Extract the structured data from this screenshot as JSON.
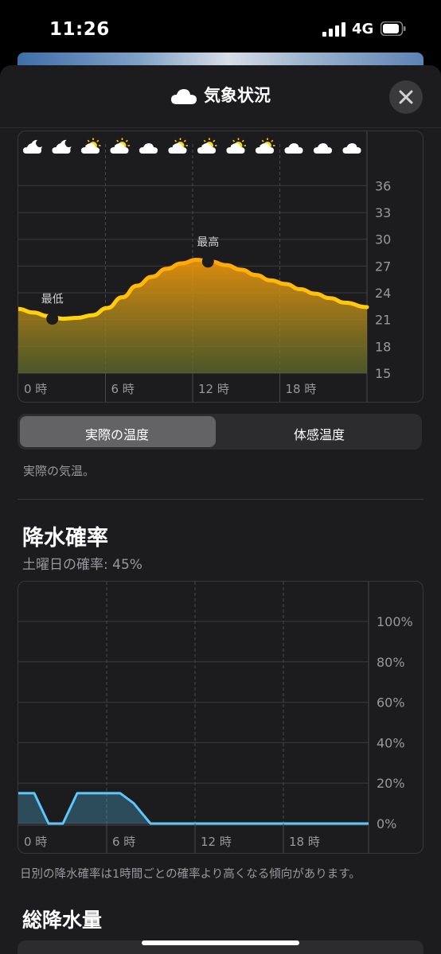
{
  "status": {
    "time": "11:26",
    "network": "4G"
  },
  "header": {
    "title": "気象状況",
    "icon": "cloud-icon",
    "close_icon": "close-icon"
  },
  "temperature": {
    "hour_icons": [
      "moon-cloud",
      "moon-cloud",
      "sun-cloud",
      "sun-cloud",
      "cloud",
      "sun-cloud",
      "sun-cloud",
      "sun-cloud",
      "sun-cloud",
      "cloud",
      "cloud",
      "cloud"
    ],
    "low_label": "最低",
    "high_label": "最高",
    "y_ticks": [
      "36",
      "33",
      "30",
      "27",
      "24",
      "21",
      "18",
      "15"
    ],
    "x_ticks": [
      "0 時",
      "6 時",
      "12 時",
      "18 時"
    ]
  },
  "chart_data": [
    {
      "type": "area",
      "x": [
        0,
        1,
        2,
        3,
        4,
        5,
        6,
        7,
        8,
        9,
        10,
        11,
        12,
        13,
        14,
        15,
        16,
        17,
        18,
        19,
        20,
        21,
        22,
        23
      ],
      "values": [
        22.2,
        21.8,
        21.4,
        21.1,
        21.2,
        21.5,
        22.3,
        23.5,
        24.8,
        25.8,
        26.7,
        27.3,
        27.7,
        27.5,
        27.1,
        26.6,
        26,
        25.4,
        25,
        24.4,
        23.9,
        23.4,
        22.9,
        22.4
      ],
      "ylim": [
        15,
        38
      ],
      "low": {
        "x": 3,
        "y": 21.1,
        "label": "最低"
      },
      "high": {
        "x": 13,
        "y": 27.5,
        "label": "最高"
      },
      "grid": true,
      "colors": {
        "line": "#ffa60a",
        "high": "#ffaa0f",
        "low": "#ffd60a"
      }
    },
    {
      "type": "area",
      "x": [
        0,
        1,
        2,
        3,
        4,
        5,
        6,
        7,
        8,
        9,
        10,
        11,
        12,
        13,
        14,
        15,
        16,
        17,
        18,
        19,
        20,
        21,
        22,
        23
      ],
      "values": [
        15,
        15,
        0,
        0,
        15,
        15,
        15,
        15,
        10,
        0,
        0,
        0,
        0,
        0,
        0,
        0,
        0,
        0,
        0,
        0,
        0,
        0,
        0,
        0
      ],
      "ylim": [
        0,
        100
      ],
      "y_ticks": [
        "100%",
        "80%",
        "60%",
        "40%",
        "20%",
        "0%"
      ],
      "x_ticks": [
        "0 時",
        "6 時",
        "12 時",
        "18 時"
      ],
      "grid": true,
      "colors": {
        "line": "#5ac8fa"
      }
    }
  ],
  "segment": {
    "options": [
      "実際の温度",
      "体感温度"
    ],
    "selected": "実際の温度"
  },
  "temp_note": "実際の気温。",
  "precip": {
    "title": "降水確率",
    "subtitle": "土曜日の確率: 45%",
    "note": "日別の降水確率は1時間ごとの確率より高くなる傾向があります。"
  },
  "total": {
    "title": "総降水量"
  }
}
